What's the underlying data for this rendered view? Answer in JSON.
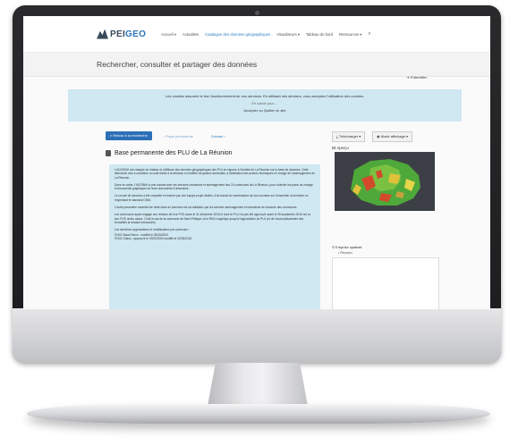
{
  "nav": {
    "logo_prefix": "PEI",
    "logo_suffix": "GEO",
    "items": [
      {
        "label": "Accueil ▾",
        "active": false
      },
      {
        "label": "Actualités",
        "active": false
      },
      {
        "label": "Catalogue des données géographiques",
        "active": true
      },
      {
        "label": "Visualiseurs ▾",
        "active": false
      },
      {
        "label": "Tableau de bord",
        "active": false
      },
      {
        "label": "Ressources ▾",
        "active": false
      }
    ],
    "search_icon": "⌕"
  },
  "page": {
    "heading": "Rechercher, consulter et partager des données",
    "signin": "S'identifier"
  },
  "cookie": {
    "message": "Les cookies assurent le bon fonctionnement de nos services. En utilisant ces derniers, vous acceptez l'utilisation des cookies.",
    "more": "En savoir plus ...",
    "actions": "Accepter ou Quitter ce site"
  },
  "toolbar": {
    "back": "Retour à la recherche",
    "prev": "Page précédente",
    "next": "Suivant",
    "download": "Télécharger ▾",
    "mode": "Mode affichage ▾"
  },
  "document": {
    "title": "Base permanente des PLU de La Réunion",
    "paragraphs": [
      "L'AGORAH est chargée de réaliser et d'diffuser des données géographiques des PLU en vigueur à l'échelle de La Réunion sur la base de données. Cette démarche vise à constituer un outil d'aide à la décision en matière de gestion territoriale, à destination des acteurs techniques en charge de l'aménagement de La Réunion.",
      "Dans ce cadre, l'AGORAH a pris contact avec les services urbanisme et aménagement des 24 communes de La Réunion, pour collecter les plans de zonage et documents graphiques de leurs documents d'urbanisme.",
      "Le recueil de données a été complété en interne par une équipe projet dédiée, d'un travail de numérisation de ces données sur l'ensemble du territoire en respectant le standard CNIG.",
      "L'autre paramètre essentiel de cette base de données est sa validation par les services aménagement et urbanisme de chacune des communes.",
      "Les communes ayant engagé une révision de leur POS avant le 31 décembre 2015 et dont le PLU n'a pas été approuvé avant le 26 septembre 2016 ont vu leur POS rendu caduc. C'est le cas de la commune de Saint-Philippe où le RNU s'applique jusqu'à l'approbation du PLU (et de l'accomplissement des formalités la rendant exécutoire).",
      "Les dernières approbations et modifications par commune :",
      "97401 Bras-Panon : modifié le 25/05/2020",
      "97402 Cilaos : approuvé le 29/02/2000 modifié le 02/05/2018"
    ]
  },
  "side": {
    "apercu": "Aperçu",
    "emprise": "Emprise spatiale",
    "emprise_value": "• Réunion"
  },
  "colors": {
    "accent": "#2a7fc4",
    "primary_button": "#2c6fb7",
    "info_bg": "#cfe8f2",
    "map_bg": "#3c3f46"
  }
}
